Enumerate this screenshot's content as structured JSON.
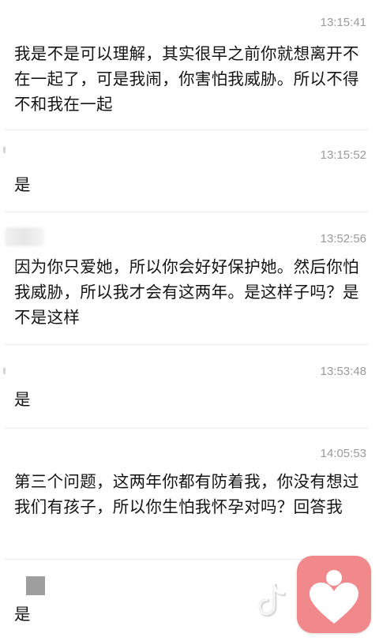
{
  "messages": [
    {
      "time": "13:15:41",
      "text": "我是不是可以理解，其实很早之前你就想离开不在一起了，可是我闹，你害怕我威胁。所以不得不和我在一起"
    },
    {
      "time": "13:15:52",
      "text": "是"
    },
    {
      "time": "13:52:56",
      "text": "  因为你只爱她，所以你会好好保护她。然后你怕我威胁，所以我才会有这两年。是这样子吗？是不是这样"
    },
    {
      "time": "13:53:48",
      "text": "是"
    },
    {
      "time": "14:05:53",
      "text": "第三个问题，这两年你都有防着我，你没有想过我们有孩子，所以你生怕我怀孕对吗？回答我"
    },
    {
      "time": "",
      "text": "是"
    }
  ],
  "overlays": {
    "watermark_icon": "tiktok-logo-icon",
    "app_badge_icon": "heart-person-icon",
    "badge_color": "#f0888c"
  }
}
